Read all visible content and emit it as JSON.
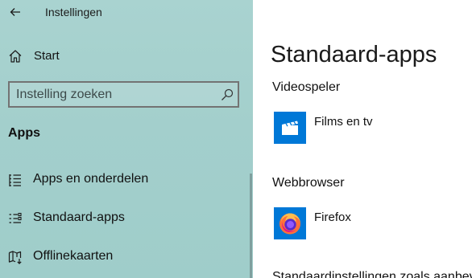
{
  "window": {
    "title": "Instellingen"
  },
  "sidebar": {
    "home_label": "Start",
    "search": {
      "placeholder": "Instelling zoeken"
    },
    "section_title": "Apps",
    "items": [
      {
        "label": "Apps en onderdelen",
        "icon": "apps-list-icon"
      },
      {
        "label": "Standaard-apps",
        "icon": "default-apps-icon"
      },
      {
        "label": "Offlinekaarten",
        "icon": "offline-maps-icon"
      }
    ]
  },
  "main": {
    "title": "Standaard-apps",
    "categories": [
      {
        "label": "Videospeler",
        "app_name": "Films en tv",
        "app_icon": "films-tv-icon",
        "icon_bg": "#0078d7"
      },
      {
        "label": "Webbrowser",
        "app_name": "Firefox",
        "app_icon": "firefox-icon",
        "icon_bg": "#0078d7"
      }
    ],
    "footer_text": "Standaardinstellingen zoals aanbevolen door Microsoft"
  },
  "colors": {
    "sidebar_bg": "#a5d0cd",
    "accent": "#0078d7"
  }
}
